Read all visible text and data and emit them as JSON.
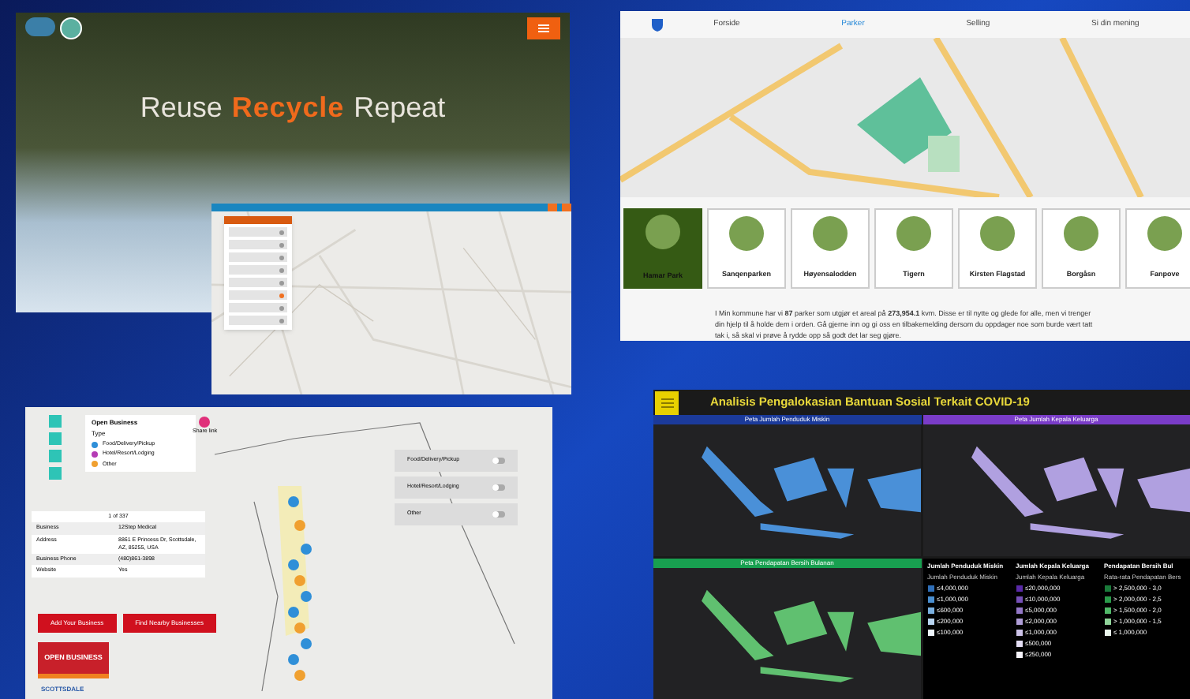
{
  "recycle_site": {
    "headline": [
      {
        "text": "Reuse",
        "accent": false
      },
      {
        "text": "Recycle",
        "accent": true
      },
      {
        "text": "Repeat",
        "accent": false
      }
    ]
  },
  "recycle_map": {
    "filters": [
      {
        "selected": false
      },
      {
        "selected": false
      },
      {
        "selected": false
      },
      {
        "selected": false
      },
      {
        "selected": false
      },
      {
        "selected": true
      },
      {
        "selected": false
      },
      {
        "selected": false
      }
    ]
  },
  "parks_site": {
    "nav": [
      {
        "label": "Forside",
        "selected": false
      },
      {
        "label": "Parker",
        "selected": true
      },
      {
        "label": "Selling",
        "selected": false
      },
      {
        "label": "Si din mening",
        "selected": false
      }
    ],
    "parks": [
      {
        "name": "Hamar Park",
        "selected": true
      },
      {
        "name": "Sanqenparken",
        "selected": false
      },
      {
        "name": "Høyensalodden",
        "selected": false
      },
      {
        "name": "Tigern",
        "selected": false
      },
      {
        "name": "Kirsten Flagstad",
        "selected": false
      },
      {
        "name": "Borgåsn",
        "selected": false
      },
      {
        "name": "Fanpove",
        "selected": false
      }
    ],
    "intro": "I Min kommune har vi **87** parker som utgjør et areal på **273,954.1** kvm. Disse er til nytte og glede for alle, men vi trenger din hjelp til å holde dem i orden. Gå gjerne inn og gi oss en tilbakemelding dersom du oppdager noe som burde vært tatt tak i, så skal vi prøve å rydde opp så godt det lar seg gjøre."
  },
  "business_map": {
    "legend_title": "Open Business",
    "legend_subtitle": "Type",
    "legend": [
      {
        "label": "Food/Delivery/Pickup",
        "color": "#2f8fd8"
      },
      {
        "label": "Hotel/Resort/Lodging",
        "color": "#b43cb4"
      },
      {
        "label": "Other",
        "color": "#f0a030"
      }
    ],
    "share_label": "Share link",
    "toggles": [
      {
        "label": "Food/Delivery/Pickup",
        "on": false
      },
      {
        "label": "Hotel/Resort/Lodging",
        "on": false
      },
      {
        "label": "Other",
        "on": false
      }
    ],
    "pager": "1 of 337",
    "details": [
      {
        "label": "Business",
        "value": "12Step Medical"
      },
      {
        "label": "Address",
        "value": "8861 E Princess Dr, Scottsdale, AZ, 85255, USA"
      },
      {
        "label": "Business Phone",
        "value": "(480)861-3898"
      },
      {
        "label": "Website",
        "value": "Yes"
      }
    ],
    "buttons": [
      "Add Your Business",
      "Find Nearby Businesses"
    ],
    "badge": [
      "OPEN",
      "BUSINESS"
    ],
    "city_logo": "SCOTTSDALE"
  },
  "covid_dashboard": {
    "title": "Analisis Pengalokasian Bantuan Sosial Terkait COVID-19",
    "maps": [
      {
        "title": "Peta Jumlah Penduduk Miskin",
        "color": "#1b3a9a"
      },
      {
        "title": "Peta Jumlah Kepala Keluarga",
        "color": "#7a3cc8"
      },
      {
        "title": "Peta Pendapatan Bersih Bulanan",
        "color": "#18a050"
      }
    ],
    "legends": [
      {
        "title": "Jumlah Penduduk Miskin",
        "subtitle": "Jumlah Penduduk Miskin",
        "items": [
          {
            "label": "≤4,000,000",
            "color": "#2f6fb8"
          },
          {
            "label": "≤1,000,000",
            "color": "#4a8fd0"
          },
          {
            "label": "≤600,000",
            "color": "#7ab0e0"
          },
          {
            "label": "≤200,000",
            "color": "#b8d4f0"
          },
          {
            "label": "≤100,000",
            "color": "#eef4fb"
          }
        ]
      },
      {
        "title": "Jumlah Kepala Keluarga",
        "subtitle": "Jumlah Kepala Keluarga",
        "items": [
          {
            "label": "≤20,000,000",
            "color": "#5a2aa8"
          },
          {
            "label": "≤10,000,000",
            "color": "#7650b8"
          },
          {
            "label": "≤5,000,000",
            "color": "#9478c8"
          },
          {
            "label": "≤2,000,000",
            "color": "#b09ed8"
          },
          {
            "label": "≤1,000,000",
            "color": "#ccc2e8"
          },
          {
            "label": "≤500,000",
            "color": "#e4def4"
          },
          {
            "label": "≤250,000",
            "color": "#f6f4fb"
          }
        ]
      },
      {
        "title": "Pendapatan Bersih Bul",
        "subtitle": "Rata-rata Pendapatan Bers",
        "items": [
          {
            "label": "> 2,500,000 - 3,0",
            "color": "#1a7a3a"
          },
          {
            "label": "> 2,000,000 - 2,5",
            "color": "#2a9a4a"
          },
          {
            "label": "> 1,500,000 - 2,0",
            "color": "#50b868"
          },
          {
            "label": "> 1,000,000 - 1,5",
            "color": "#90d49a"
          },
          {
            "label": "≤ 1,000,000",
            "color": "#eaf6ec"
          }
        ]
      }
    ]
  }
}
